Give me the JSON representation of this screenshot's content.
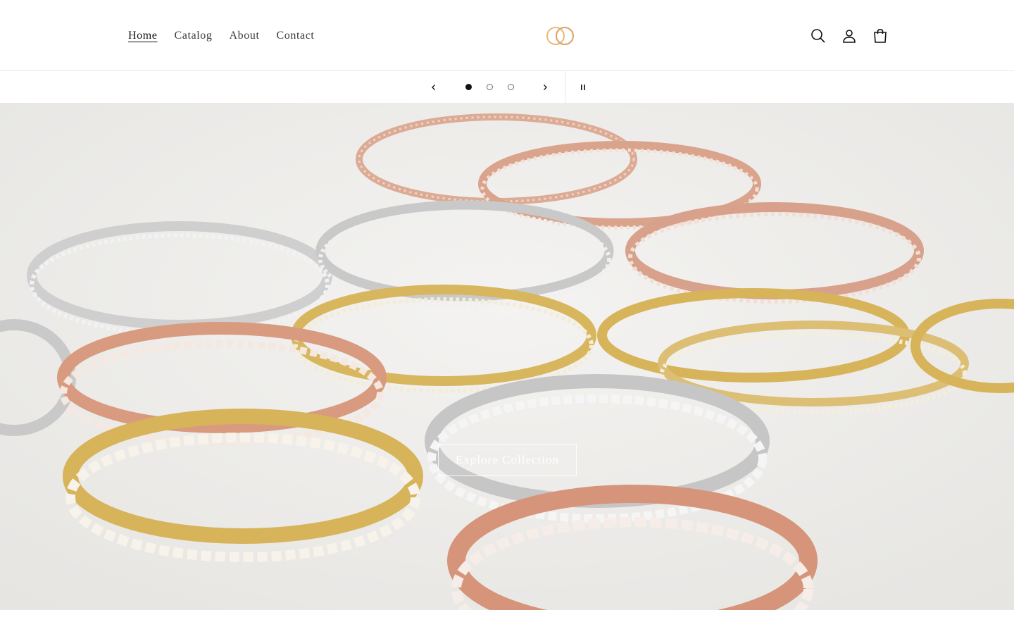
{
  "nav": {
    "items": [
      {
        "label": "Home",
        "active": true
      },
      {
        "label": "Catalog",
        "active": false
      },
      {
        "label": "About",
        "active": false
      },
      {
        "label": "Contact",
        "active": false
      }
    ]
  },
  "header": {
    "icons": [
      "search-icon",
      "account-icon",
      "cart-icon"
    ],
    "logo_colors": [
      "#e9b97a",
      "#d89a55"
    ]
  },
  "slideshow": {
    "slide_count": 3,
    "current_slide": 1,
    "icons": [
      "chevron-left-icon",
      "chevron-right-icon",
      "pause-icon"
    ]
  },
  "hero": {
    "cta_label": "Explore Collection"
  },
  "colors": {
    "gold": "#d9b65c",
    "rose": "#d69b83",
    "silver": "#c8c8c8",
    "background": "#efeeec"
  }
}
